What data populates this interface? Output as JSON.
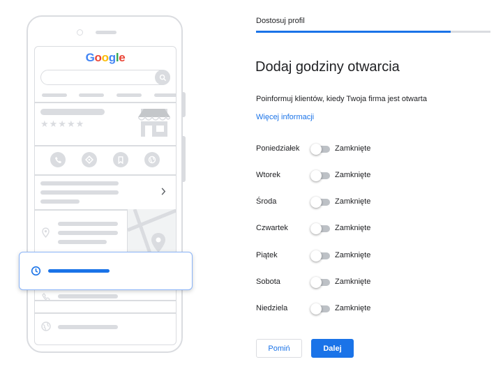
{
  "colors": {
    "accent": "#1a73e8",
    "illustration_gray": "#dadce0",
    "track_off": "#bdc1c6"
  },
  "illustration": {
    "logo_letters": [
      {
        "ch": "G",
        "cls": "b"
      },
      {
        "ch": "o",
        "cls": "r"
      },
      {
        "ch": "o",
        "cls": "y"
      },
      {
        "ch": "g",
        "cls": "b"
      },
      {
        "ch": "l",
        "cls": "g"
      },
      {
        "ch": "e",
        "cls": "r"
      }
    ],
    "stars": "★★★★★",
    "action_icons": [
      "phone-icon",
      "directions-icon",
      "bookmark-icon",
      "website-icon"
    ]
  },
  "header": {
    "step_title": "Dostosuj profil",
    "progress": 0.83
  },
  "form": {
    "heading": "Dodaj godziny otwarcia",
    "subtitle": "Poinformuj klientów, kiedy Twoja firma jest otwarta",
    "more_link": "Więcej informacji",
    "days": [
      {
        "name": "Poniedziałek",
        "status": "Zamknięte",
        "open": false
      },
      {
        "name": "Wtorek",
        "status": "Zamknięte",
        "open": false
      },
      {
        "name": "Środa",
        "status": "Zamknięte",
        "open": false
      },
      {
        "name": "Czwartek",
        "status": "Zamknięte",
        "open": false
      },
      {
        "name": "Piątek",
        "status": "Zamknięte",
        "open": false
      },
      {
        "name": "Sobota",
        "status": "Zamknięte",
        "open": false
      },
      {
        "name": "Niedziela",
        "status": "Zamknięte",
        "open": false
      }
    ],
    "skip_label": "Pomiń",
    "next_label": "Dalej"
  }
}
